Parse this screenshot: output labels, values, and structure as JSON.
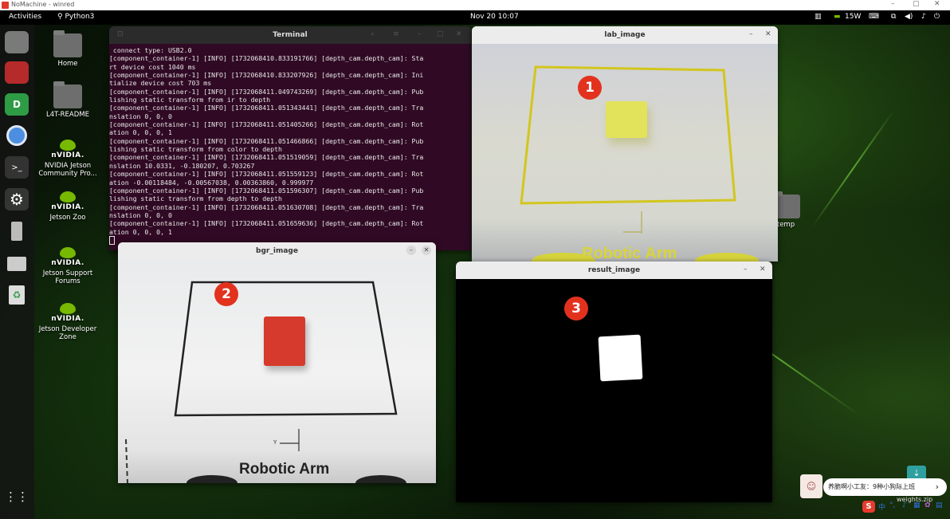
{
  "nomachine": {
    "title": "NoMachine - winred",
    "minimize": "–",
    "restore": "▢",
    "close": "✕"
  },
  "topbar": {
    "activities": "Activities",
    "app_name": "Python3",
    "clock": "Nov 20  10:07",
    "power_label": "15W"
  },
  "desktop_icons": [
    {
      "label": "Home"
    },
    {
      "label": "L4T-README"
    },
    {
      "label": "NVIDIA Jetson Community Pro..."
    },
    {
      "label": "Jetson Zoo"
    },
    {
      "label": "Jetson Support Forums"
    },
    {
      "label": "Jetson Developer Zone"
    },
    {
      "label": "temp"
    }
  ],
  "nvidia_word": "nVIDIA.",
  "terminal": {
    "title": "Terminal",
    "lines": [
      " connect type: USB2.0",
      "[component_container-1] [INFO] [1732068410.833191766] [depth_cam.depth_cam]: Sta",
      "rt device cost 1040 ms",
      "[component_container-1] [INFO] [1732068410.833207926] [depth_cam.depth_cam]: Ini",
      "tialize device cost 703 ms",
      "[component_container-1] [INFO] [1732068411.049743269] [depth_cam.depth_cam]: Pub",
      "lishing static transform from ir to depth",
      "[component_container-1] [INFO] [1732068411.051343441] [depth_cam.depth_cam]: Tra",
      "nslation 0, 0, 0",
      "[component_container-1] [INFO] [1732068411.051405266] [depth_cam.depth_cam]: Rot",
      "ation 0, 0, 0, 1",
      "[component_container-1] [INFO] [1732068411.051466866] [depth_cam.depth_cam]: Pub",
      "lishing static transform from color to depth",
      "[component_container-1] [INFO] [1732068411.051519059] [depth_cam.depth_cam]: Tra",
      "nslation 10.0331, -0.180207, 0.703267",
      "[component_container-1] [INFO] [1732068411.051559123] [depth_cam.depth_cam]: Rot",
      "ation -0.00118484, -0.00567038, 0.00363860, 0.999977",
      "[component_container-1] [INFO] [1732068411.051596307] [depth_cam.depth_cam]: Pub",
      "lishing static transform from depth to depth",
      "[component_container-1] [INFO] [1732068411.051630708] [depth_cam.depth_cam]: Tra",
      "nslation 0, 0, 0",
      "[component_container-1] [INFO] [1732068411.051659636] [depth_cam.depth_cam]: Rot",
      "ation 0, 0, 0, 1"
    ]
  },
  "windows": {
    "lab": {
      "title": "lab_image",
      "marker": "1",
      "board_text": "Robotic Arm"
    },
    "bgr": {
      "title": "bgr_image",
      "marker": "2",
      "board_text": "Robotic Arm",
      "axis_label": "Y"
    },
    "result": {
      "title": "result_image",
      "marker": "3"
    }
  },
  "notification": {
    "text": "养脆啊小工友：9种小狗际上班",
    "arrow": "›"
  },
  "weights_label": "weights.zip",
  "colors": {
    "terminal_bg": "#300a24",
    "cube_red": "#d63a2c",
    "cube_yellow": "#e2e35a",
    "marker": "#e2321e",
    "nvidia_green": "#76b900"
  }
}
